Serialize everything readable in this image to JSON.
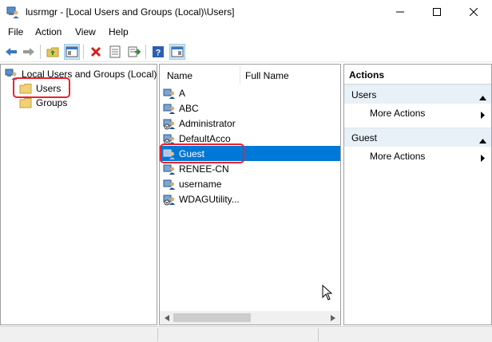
{
  "window": {
    "title": "lusrmgr - [Local Users and Groups (Local)\\Users]"
  },
  "menu": {
    "items": [
      "File",
      "Action",
      "View",
      "Help"
    ]
  },
  "toolbar": {
    "icons": [
      "back-icon",
      "forward-icon",
      "up-folder-icon",
      "show-hide-console-tree-icon",
      "delete-icon",
      "properties-icon",
      "export-list-icon",
      "help-icon",
      "show-hide-action-pane-icon"
    ]
  },
  "tree": {
    "root": "Local Users and Groups (Local)",
    "children": [
      "Users",
      "Groups"
    ]
  },
  "list": {
    "columns": [
      "Name",
      "Full Name"
    ],
    "rows": [
      {
        "name": "A",
        "full_name": ""
      },
      {
        "name": "ABC",
        "full_name": ""
      },
      {
        "name": "Administrator",
        "full_name": ""
      },
      {
        "name": "DefaultAcco",
        "full_name": ""
      },
      {
        "name": "Guest",
        "full_name": ""
      },
      {
        "name": "RENEE-CN",
        "full_name": ""
      },
      {
        "name": "username",
        "full_name": ""
      },
      {
        "name": "WDAGUtility...",
        "full_name": ""
      }
    ],
    "selected": "Guest"
  },
  "actions": {
    "title": "Actions",
    "sections": [
      {
        "header": "Users",
        "items": [
          "More Actions"
        ]
      },
      {
        "header": "Guest",
        "items": [
          "More Actions"
        ]
      }
    ]
  },
  "colors": {
    "selection": "#0078d7",
    "highlight_box": "#e8232f",
    "actions_section_bg": "#e8f0f8"
  }
}
